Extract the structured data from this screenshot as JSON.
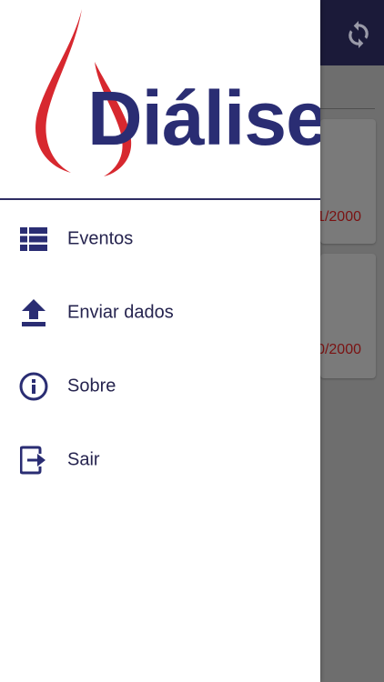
{
  "app": {
    "logo_text": "Diálise"
  },
  "toolbar": {
    "sync_icon": "sync-icon"
  },
  "background_list": {
    "cards": [
      {
        "date_fragment": "1/2000"
      },
      {
        "date_fragment": "0/2000"
      }
    ]
  },
  "drawer": {
    "menu": [
      {
        "label": "Eventos",
        "icon": "list-icon"
      },
      {
        "label": "Enviar dados",
        "icon": "upload-icon"
      },
      {
        "label": "Sobre",
        "icon": "info-icon"
      },
      {
        "label": "Sair",
        "icon": "exit-icon"
      }
    ]
  },
  "colors": {
    "primary": "#1b1a39",
    "menu_text": "#26244f",
    "logo_blue": "#2a2d73",
    "logo_red": "#d7282f",
    "date_red": "#7a1212"
  }
}
